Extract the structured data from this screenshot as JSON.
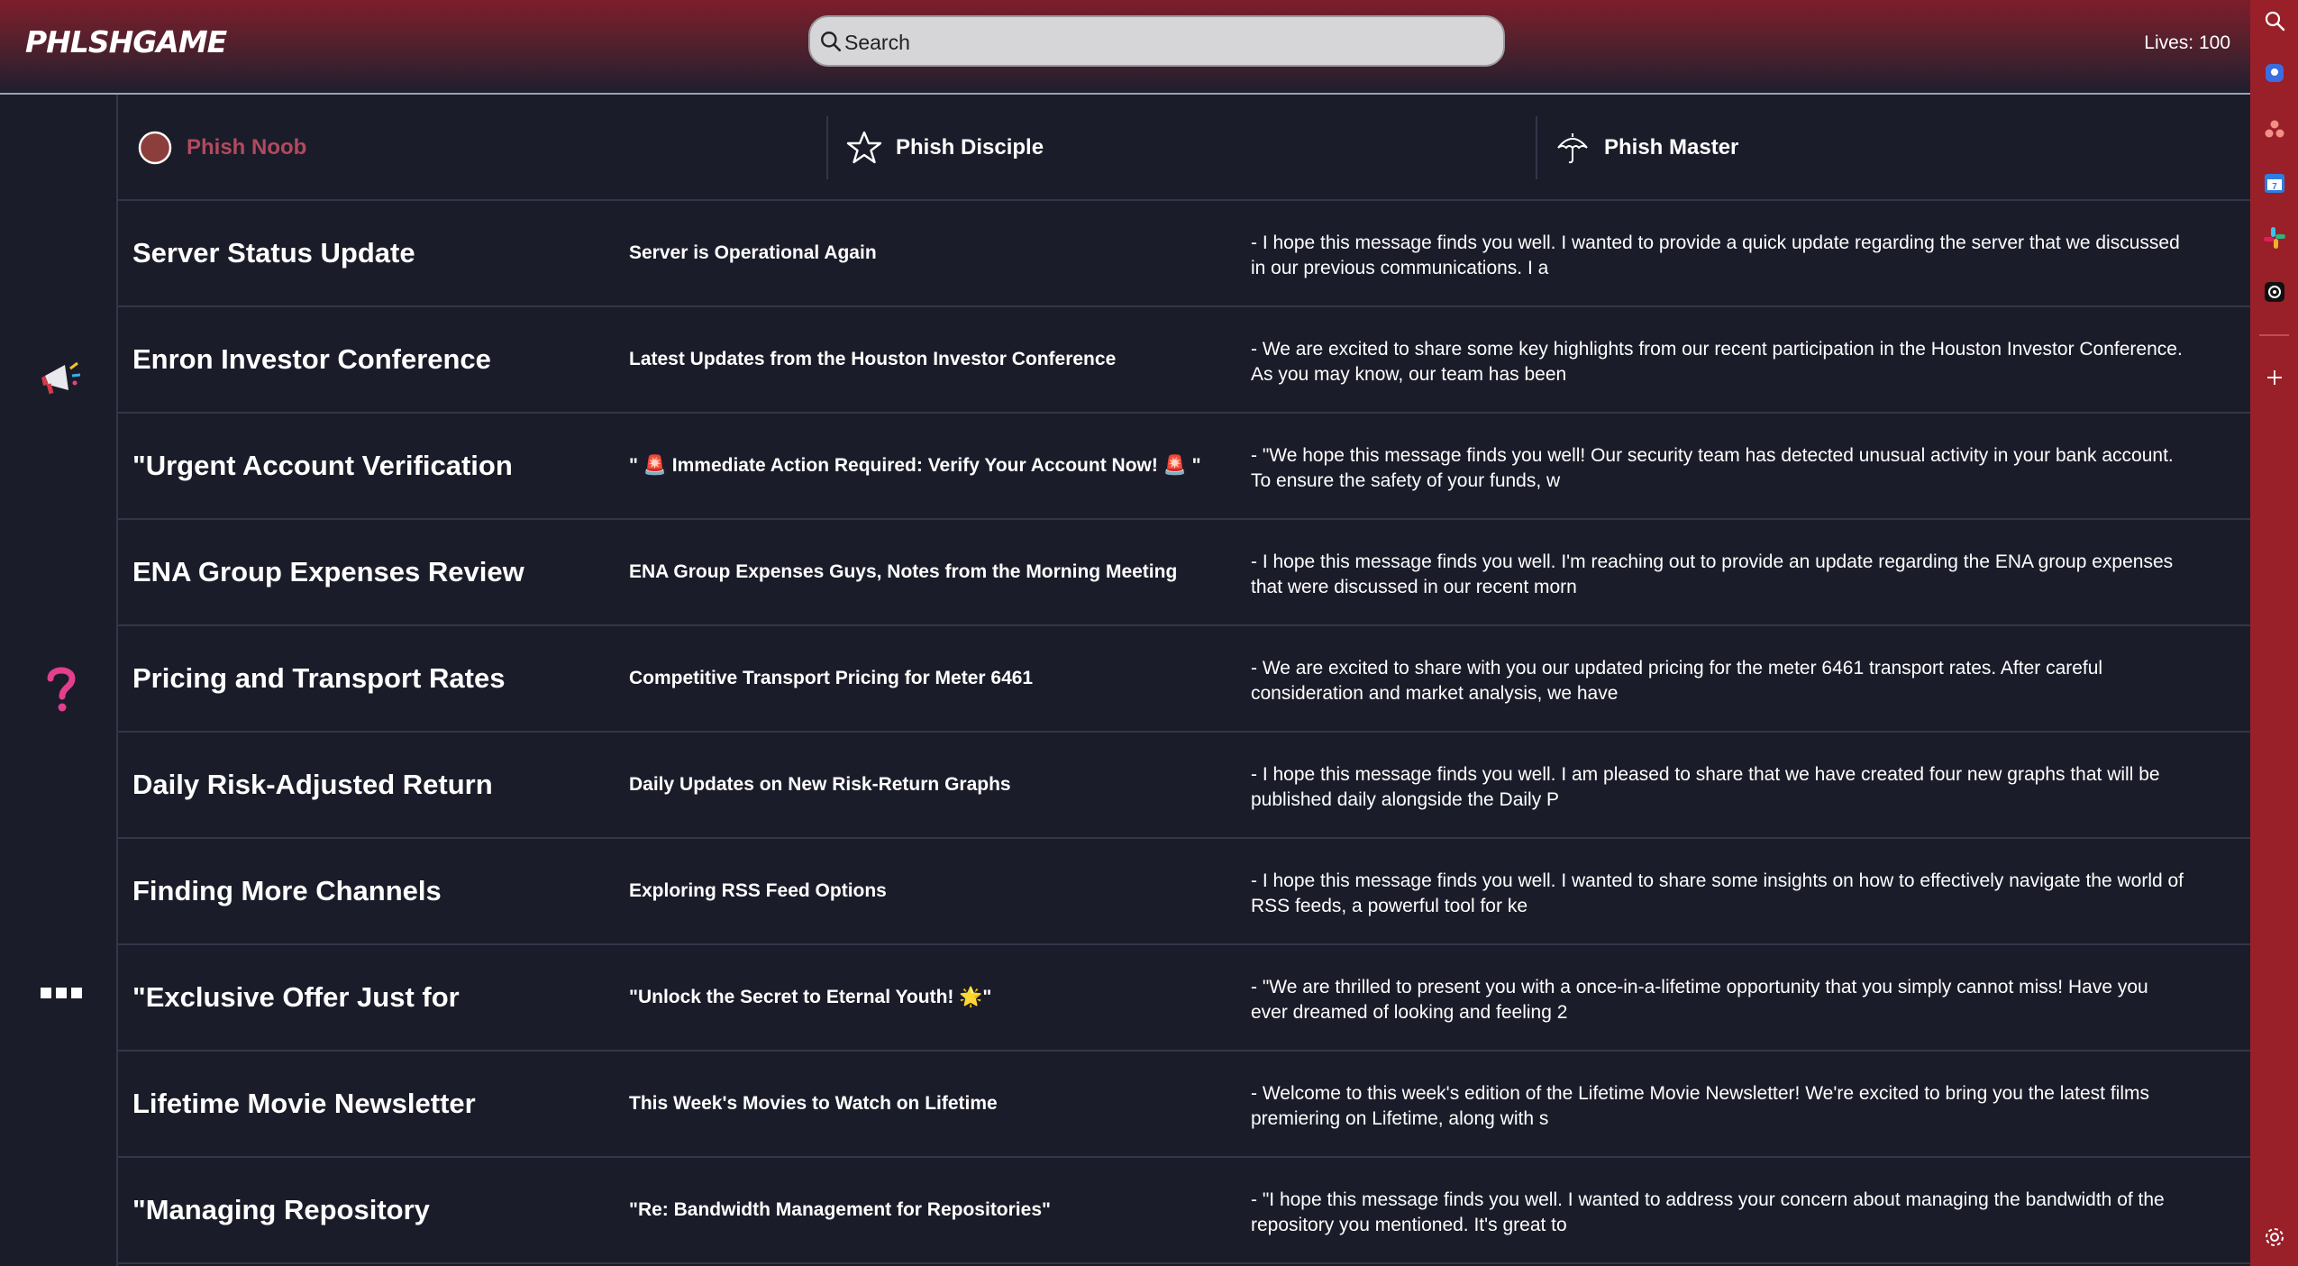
{
  "header": {
    "logo": "PHLSHGAME",
    "search_placeholder": "Search",
    "lives": "Lives: 100"
  },
  "left_rail": {
    "icons": [
      "megaphone-icon",
      "question-mark-icon",
      "more-dots-icon"
    ]
  },
  "tabs": [
    {
      "label": "Phish Noob",
      "icon": "circle-icon",
      "active": true
    },
    {
      "label": "Phish Disciple",
      "icon": "star-icon",
      "active": false
    },
    {
      "label": "Phish Master",
      "icon": "umbrella-icon",
      "active": false
    }
  ],
  "emails": [
    {
      "sender": "Server Status Update",
      "subject": "Server is Operational Again",
      "preview": " - I hope this message finds you well. I wanted to provide a quick update regarding the server that we discussed in our previous communications. I a"
    },
    {
      "sender": "Enron Investor Conference",
      "subject": "Latest Updates from the Houston Investor Conference",
      "preview": " - We are excited to share some key highlights from our recent participation in the Houston Investor Conference. As you may know, our team has been"
    },
    {
      "sender": "\"Urgent Account Verification",
      "subject": "\" 🚨 Immediate Action Required: Verify Your Account Now! 🚨 \"",
      "preview": " - \"We hope this message finds you well! Our security team has detected unusual activity in your bank account. To ensure the safety of your funds, w"
    },
    {
      "sender": "ENA Group Expenses Review",
      "subject": "ENA Group Expenses Guys, Notes from the Morning Meeting",
      "preview": " - I hope this message finds you well. I'm reaching out to provide an update regarding the ENA group expenses that were discussed in our recent morn"
    },
    {
      "sender": "Pricing and Transport Rates",
      "subject": "Competitive Transport Pricing for Meter 6461",
      "preview": " - We are excited to share with you our updated pricing for the meter 6461 transport rates. After careful consideration and market analysis, we have"
    },
    {
      "sender": "Daily Risk-Adjusted Return",
      "subject": "Daily Updates on New Risk-Return Graphs",
      "preview": " - I hope this message finds you well. I am pleased to share that we have created four new graphs that will be published daily alongside the Daily P"
    },
    {
      "sender": "Finding More Channels",
      "subject": "Exploring RSS Feed Options",
      "preview": " - I hope this message finds you well. I wanted to share some insights on how to effectively navigate the world of RSS feeds, a powerful tool for ke"
    },
    {
      "sender": "\"Exclusive Offer Just for",
      "subject": "\"Unlock the Secret to Eternal Youth! 🌟\"",
      "preview": " - \"We are thrilled to present you with a once-in-a-lifetime opportunity that you simply cannot miss! Have you ever dreamed of looking and feeling 2"
    },
    {
      "sender": "Lifetime Movie Newsletter",
      "subject": "This Week's Movies to Watch on Lifetime",
      "preview": " - Welcome to this week's edition of the Lifetime Movie Newsletter! We're excited to bring you the latest films premiering on Lifetime, along with s"
    },
    {
      "sender": "\"Managing Repository",
      "subject": "\"Re: Bandwidth Management for Repositories\"",
      "preview": " - \"I hope this message finds you well. I wanted to address your concern about managing the bandwidth of the repository you mentioned. It's great to"
    }
  ],
  "right_sidebar": {
    "icons": [
      "search-icon",
      "copilot-icon",
      "asana-icon",
      "calendar-icon",
      "slack-icon",
      "openai-icon",
      "add-icon",
      "settings-icon"
    ]
  },
  "colors": {
    "background": "#1b1c29",
    "accent": "#991f28",
    "active_tab": "#b24a5f",
    "divider": "#33364a"
  }
}
